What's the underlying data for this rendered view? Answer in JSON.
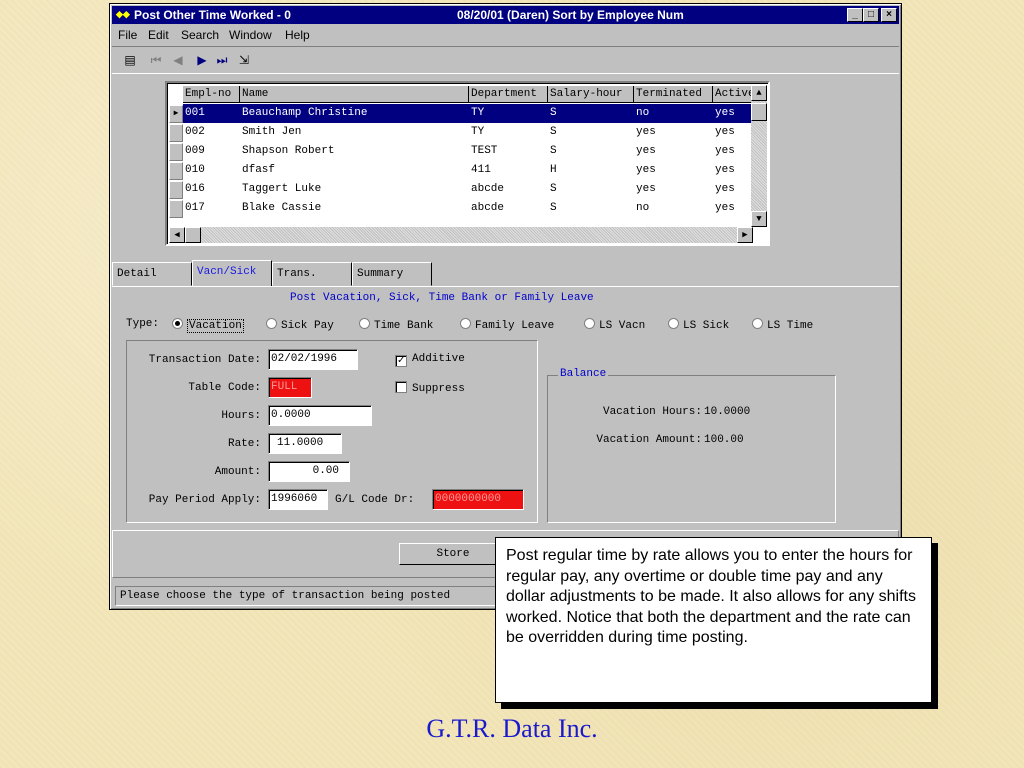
{
  "window": {
    "title": "Post Other Time Worked - 0",
    "title_right": "08/20/01 (Daren) Sort by Employee Num",
    "controls": [
      "_",
      "□",
      "×"
    ]
  },
  "menu": [
    "File",
    "Edit",
    "Search",
    "Window",
    "Help"
  ],
  "grid": {
    "columns": [
      "Empl-no",
      "Name",
      "Department",
      "Salary-hour",
      "Terminated",
      "Active"
    ],
    "rows": [
      [
        "001",
        "Beauchamp Christine",
        "TY",
        "S",
        "no",
        "yes"
      ],
      [
        "002",
        "Smith Jen",
        "TY",
        "S",
        "yes",
        "yes"
      ],
      [
        "009",
        "Shapson Robert",
        "TEST",
        "S",
        "yes",
        "yes"
      ],
      [
        "010",
        "dfasf",
        "411",
        "H",
        "yes",
        "yes"
      ],
      [
        "016",
        "Taggert Luke",
        "abcde",
        "S",
        "yes",
        "yes"
      ],
      [
        "017",
        "Blake Cassie",
        "abcde",
        "S",
        "no",
        "yes"
      ]
    ]
  },
  "tabs": [
    "Detail",
    "Vacn/Sick",
    "Trans.",
    "Summary"
  ],
  "caption": "Post Vacation, Sick, Time Bank or Family Leave",
  "type": {
    "label": "Type:",
    "options": [
      "Vacation",
      "Sick Pay",
      "Time Bank",
      "Family Leave",
      "LS Vacn",
      "LS Sick",
      "LS Time"
    ]
  },
  "form": {
    "transaction_date_label": "Transaction Date:",
    "transaction_date": "02/02/1996",
    "table_code_label": "Table Code:",
    "table_code": "FULL",
    "hours_label": "Hours:",
    "hours": "0.0000",
    "rate_label": "Rate:",
    "rate": "11.0000",
    "amount_label": "Amount:",
    "amount": "0.00",
    "pay_period_label": "Pay Period Apply:",
    "pay_period": "1996060",
    "gl_label": "G/L Code Dr:",
    "gl_code": "0000000000",
    "additive_label": "Additive",
    "suppress_label": "Suppress"
  },
  "balance": {
    "title": "Balance",
    "vac_hours_label": "Vacation Hours:",
    "vac_hours": "10.0000",
    "vac_amount_label": "Vacation Amount:",
    "vac_amount": "100.00"
  },
  "store_label": "Store",
  "status": "Please choose the type of transaction being posted",
  "callout": "Post regular time by rate allows you to enter the hours for regular pay, any overtime or double time pay and any dollar adjustments to be made.  It also allows for any shifts worked. Notice that both the department and the rate can be overridden during time posting.",
  "brand": "G.T.R. Data Inc."
}
